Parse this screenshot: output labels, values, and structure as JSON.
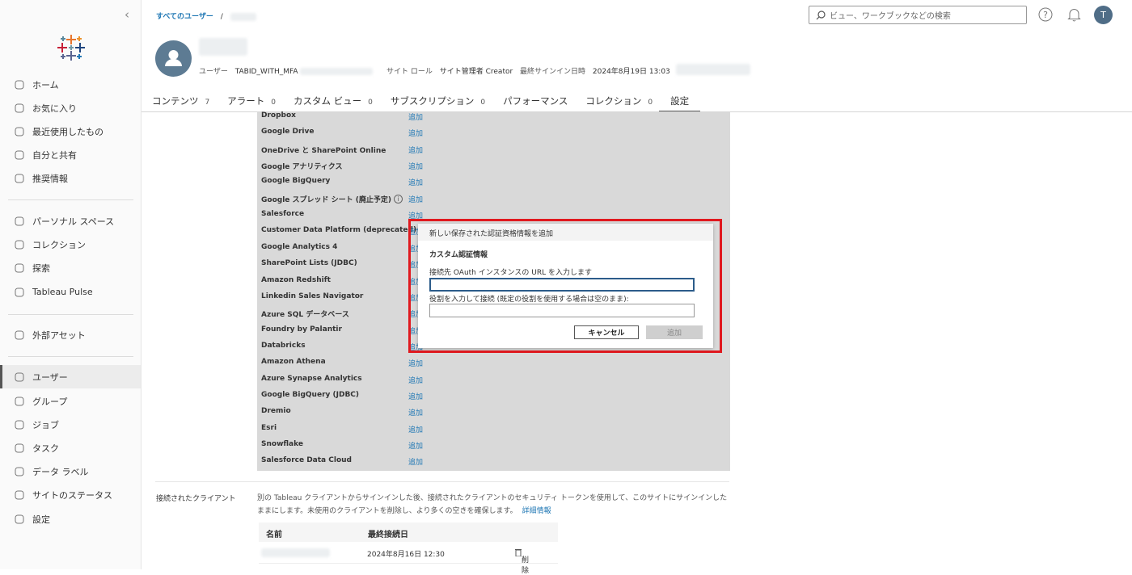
{
  "sidebar": {
    "items": [
      {
        "label": "ホーム",
        "icon": "home-icon"
      },
      {
        "label": "お気に入り",
        "icon": "star-icon"
      },
      {
        "label": "最近使用したもの",
        "icon": "history-icon"
      },
      {
        "label": "自分と共有",
        "icon": "shared-icon"
      },
      {
        "label": "推奨情報",
        "icon": "lightbulb-icon"
      },
      {
        "label": "パーソナル スペース",
        "icon": "person-icon"
      },
      {
        "label": "コレクション",
        "icon": "collection-icon"
      },
      {
        "label": "探索",
        "icon": "compass-icon"
      },
      {
        "label": "Tableau Pulse",
        "icon": "pulse-icon"
      },
      {
        "label": "外部アセット",
        "icon": "archive-icon"
      },
      {
        "label": "ユーザー",
        "icon": "users-icon"
      },
      {
        "label": "グループ",
        "icon": "group-icon"
      },
      {
        "label": "ジョブ",
        "icon": "job-icon"
      },
      {
        "label": "タスク",
        "icon": "task-icon"
      },
      {
        "label": "データ ラベル",
        "icon": "tag-icon"
      },
      {
        "label": "サイトのステータス",
        "icon": "status-icon"
      },
      {
        "label": "設定",
        "icon": "gear-icon"
      }
    ]
  },
  "breadcrumb": {
    "root": "すべてのユーザー",
    "sep": "/"
  },
  "search": {
    "placeholder": "ビュー、ワークブックなどの検索"
  },
  "account": {
    "initial": "T"
  },
  "user": {
    "user_label": "ユーザー",
    "user_value": "TABID_WITH_MFA",
    "role_label": "サイト ロール",
    "role_value": "サイト管理者 Creator",
    "signin_label": "最終サインイン日時",
    "signin_value": "2024年8月19日 13:03"
  },
  "tabs": [
    {
      "label": "コンテンツ",
      "count": "7"
    },
    {
      "label": "アラート",
      "count": "0"
    },
    {
      "label": "カスタム ビュー",
      "count": "0"
    },
    {
      "label": "サブスクリプション",
      "count": "0"
    },
    {
      "label": "パフォーマンス",
      "count": ""
    },
    {
      "label": "コレクション",
      "count": "0"
    },
    {
      "label": "設定",
      "count": ""
    }
  ],
  "connections": {
    "add_label": "追加",
    "items": [
      "Dropbox",
      "Google Drive",
      "OneDrive と SharePoint Online",
      "Google アナリティクス",
      "Google BigQuery",
      "Google スプレッド シート (廃止予定)",
      "Salesforce",
      "Customer Data Platform (deprecated)",
      "Google Analytics 4",
      "SharePoint Lists (JDBC)",
      "Amazon Redshift",
      "Linkedin Sales Navigator",
      "Azure SQL データベース",
      "Foundry by Palantir",
      "Databricks",
      "Amazon Athena",
      "Azure Synapse Analytics",
      "Google BigQuery (JDBC)",
      "Dremio",
      "Esri",
      "Snowflake",
      "Salesforce Data Cloud"
    ]
  },
  "dialog": {
    "header": "新しい保存された認証資格情報を追加",
    "title": "カスタム認証情報",
    "url_label": "接続先 OAuth インスタンスの URL を入力します",
    "url_value": "",
    "role_label": "役割を入力して接続 (既定の役割を使用する場合は空のまま):",
    "role_value": "",
    "cancel": "キャンセル",
    "add": "追加"
  },
  "clients": {
    "label": "接続されたクライアント",
    "desc": "別の Tableau クライアントからサインインした後、接続されたクライアントのセキュリティ トークンを使用して、このサイトにサインインしたままにします。未使用のクライアントを削除し、より多くの空きを確保します。",
    "more": "詳細情報",
    "col_name": "名前",
    "col_last": "最終接続日",
    "rows": [
      {
        "last": "2024年8月16日 12:30",
        "action": "削除"
      }
    ]
  }
}
